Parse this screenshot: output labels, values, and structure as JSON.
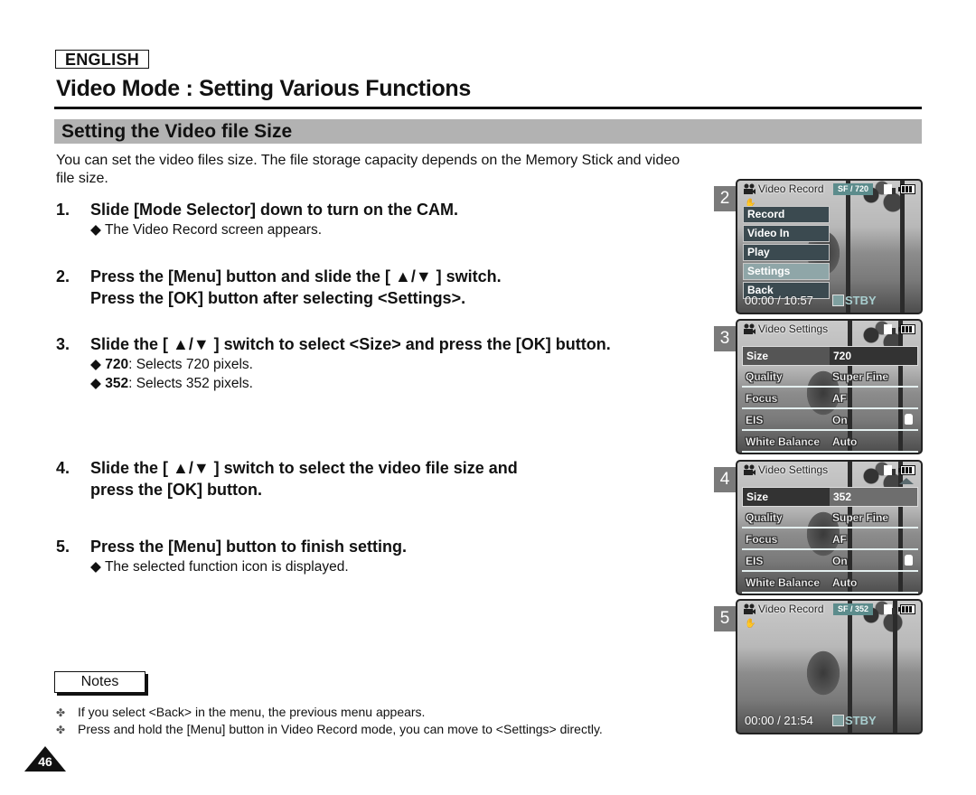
{
  "header": {
    "language": "ENGLISH",
    "page_title": "Video Mode : Setting Various Functions",
    "section_title": "Setting the Video file Size"
  },
  "intro": "You can set the video files size. The file storage capacity depends on the Memory Stick and video file size.",
  "steps": [
    {
      "num": "1.",
      "lines": [
        "Slide [Mode Selector] down to turn on the CAM."
      ],
      "subs": [
        {
          "bold": "",
          "text": "The Video Record screen appears."
        }
      ]
    },
    {
      "num": "2.",
      "lines": [
        "Press the [Menu] button and slide the [ ▲/▼ ] switch.",
        "Press the [OK] button after selecting <Settings>."
      ],
      "subs": []
    },
    {
      "num": "3.",
      "lines": [
        "Slide the [ ▲/▼ ] switch to select <Size> and press the [OK] button."
      ],
      "subs": [
        {
          "bold": "720",
          "text": ": Selects 720 pixels."
        },
        {
          "bold": "352",
          "text": ": Selects 352 pixels."
        }
      ]
    },
    {
      "num": "4.",
      "lines": [
        "Slide the [ ▲/▼ ] switch to select the video file size and",
        "press the [OK] button."
      ],
      "subs": []
    },
    {
      "num": "5.",
      "lines": [
        "Press the [Menu] button to finish setting."
      ],
      "subs": [
        {
          "bold": "",
          "text": "The selected function icon is displayed."
        }
      ]
    }
  ],
  "bullet_glyph": "◆",
  "notes": {
    "label": "Notes",
    "bullet_glyph": "✤",
    "items": [
      "If you select <Back> in the menu, the previous menu appears.",
      "Press and hold the [Menu] button in Video Record mode, you can move to <Settings> directly."
    ]
  },
  "page_number": "46",
  "screens": [
    {
      "badge": "2",
      "title": "Video Record",
      "quality_tag": "SF  /  720",
      "menu": [
        "Record",
        "Video In",
        "Play",
        "Settings",
        "Back"
      ],
      "menu_selected": "Settings",
      "time": "00:00 / 10:57",
      "status": "STBY"
    },
    {
      "badge": "3",
      "title": "Video Settings",
      "rows": [
        {
          "key": "Size",
          "value": "720"
        },
        {
          "key": "Quality",
          "value": "Super Fine"
        },
        {
          "key": "Focus",
          "value": "AF"
        },
        {
          "key": "EIS",
          "value": "On"
        },
        {
          "key": "White Balance",
          "value": "Auto"
        }
      ]
    },
    {
      "badge": "4",
      "title": "Video Settings",
      "rows": [
        {
          "key": "Size",
          "value": "352"
        },
        {
          "key": "Quality",
          "value": "Super Fine"
        },
        {
          "key": "Focus",
          "value": "AF"
        },
        {
          "key": "EIS",
          "value": "On"
        },
        {
          "key": "White Balance",
          "value": "Auto"
        }
      ]
    },
    {
      "badge": "5",
      "title": "Video Record",
      "quality_tag": "SF  /  352",
      "time": "00:00 / 21:54",
      "status": "STBY"
    }
  ],
  "colors": {
    "section_bar": "#b2b2b2",
    "osd_accent": "#5c8c8c",
    "menu_bg": "#3b4a50",
    "menu_selected": "#8fa6a8"
  }
}
